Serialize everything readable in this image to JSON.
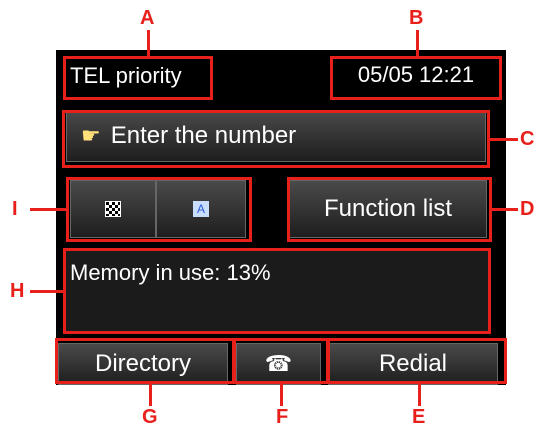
{
  "screen": {
    "status_text": "TEL priority",
    "datetime": "05/05 12:21",
    "number_prompt": "Enter the number",
    "function_list_label": "Function list",
    "memory_text": "Memory in use: 13%",
    "directory_label": "Directory",
    "redial_label": "Redial"
  },
  "callouts": {
    "a": "A",
    "b": "B",
    "c": "C",
    "d": "D",
    "e": "E",
    "f": "F",
    "g": "G",
    "h": "H",
    "i": "I"
  },
  "colors": {
    "callout": "#e8201c",
    "screen_bg": "#000000",
    "button_bg": "#3a3a3a"
  },
  "icons": [
    "hand-pointer-icon",
    "checker-quality-icon",
    "text-mode-icon",
    "hook-phone-icon"
  ]
}
